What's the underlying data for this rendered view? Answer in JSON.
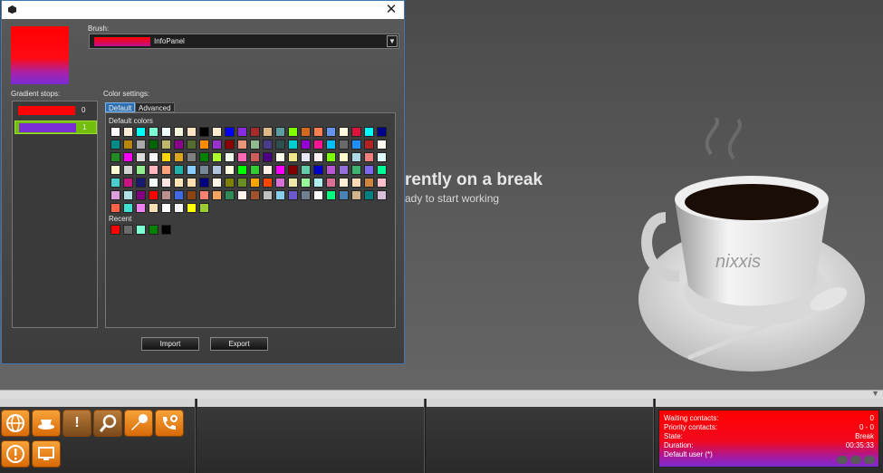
{
  "dialog": {
    "brush_label": "Brush:",
    "brush_name": "InfoPanel",
    "gradient_stops_label": "Gradient stops:",
    "color_settings_label": "Color settings:",
    "tabs": [
      "Default",
      "Advanced"
    ],
    "default_colors_label": "Default colors",
    "recent_label": "Recent",
    "stops": [
      {
        "index": "0",
        "color": "#ff0000"
      },
      {
        "index": "1",
        "color": "#7b2ed6"
      }
    ],
    "import_label": "Import",
    "export_label": "Export",
    "close_symbol": "✕",
    "default_colors": [
      [
        "#fff8ff",
        "#faebd7",
        "#00ffff",
        "#7fffd4",
        "#f0ffff",
        "#f5f5dc",
        "#ffe4c4",
        "#000000",
        "#ffebcd",
        "#0000ff",
        "#8a2be2",
        "#a52a2a",
        "#deb887",
        "#5f9ea0",
        "#7fff00",
        "#d2691e",
        "#ff7f50",
        "#6495ed",
        "#fff8dc",
        "#dc143c",
        "#00ffff",
        "#00008b"
      ],
      [
        "#008b8b",
        "#b8860b",
        "#a9a9a9",
        "#006400",
        "#bdb76b",
        "#8b008b",
        "#556b2f",
        "#ff8c00",
        "#9932cc",
        "#8b0000",
        "#e9967a",
        "#8fbc8f",
        "#483d8b",
        "#2f4f4f",
        "#00ced1",
        "#9400d3",
        "#ff1493",
        "#00bfff",
        "#696969",
        "#1e90ff",
        "#b22222",
        "#fffaf0"
      ],
      [
        "#228b22",
        "#ff00ff",
        "#dcdcdc",
        "#f8f8ff",
        "#ffd700",
        "#daa520",
        "#808080",
        "#008000",
        "#adff2f",
        "#f0fff0",
        "#ff69b4",
        "#cd5c5c",
        "#4b0082",
        "#fffff0",
        "#f0e68c",
        "#e6e6fa",
        "#fff0f5",
        "#7cfc00",
        "#fffacd",
        "#add8e6",
        "#f08080",
        "#e0ffff"
      ],
      [
        "#fafad2",
        "#d3d3d3",
        "#90ee90",
        "#ffb6c1",
        "#ffa07a",
        "#20b2aa",
        "#87cefa",
        "#778899",
        "#b0c4de",
        "#ffffe0",
        "#00ff00",
        "#32cd32",
        "#faf0e6",
        "#ff00ff",
        "#800000",
        "#66cdaa",
        "#0000cd",
        "#ba55d3",
        "#9370db",
        "#3cb371",
        "#7b68ee",
        "#00fa9a"
      ],
      [
        "#48d1cc",
        "#c71585",
        "#191970",
        "#f5fffa",
        "#ffe4e1",
        "#ffe4b5",
        "#ffdead",
        "#000080",
        "#fdf5e6",
        "#808000",
        "#6b8e23",
        "#ffa500",
        "#ff4500",
        "#da70d6",
        "#eee8aa",
        "#98fb98",
        "#afeeee",
        "#db7093",
        "#ffefd5",
        "#ffdab9",
        "#cd853f",
        "#ffc0cb"
      ],
      [
        "#dda0dd",
        "#b0e0e6",
        "#800080",
        "#ff0000",
        "#bc8f8f",
        "#4169e1",
        "#8b4513",
        "#fa8072",
        "#f4a460",
        "#2e8b57",
        "#fff5ee",
        "#a0522d",
        "#c0c0c0",
        "#87ceeb",
        "#6a5acd",
        "#708090",
        "#fffafa",
        "#00ff7f",
        "#4682b4",
        "#d2b48c",
        "#008080",
        "#d8bfd8"
      ],
      [
        "#ff6347",
        "#40e0d0",
        "#ee82ee",
        "#f5deb3",
        "#ffffff",
        "#f5f5f5",
        "#ffff00",
        "#9acd32"
      ]
    ],
    "recent_colors": [
      "#ff0000",
      "#6a6a6a",
      "#7fffd4",
      "#007f00",
      "#000000"
    ]
  },
  "break_screen": {
    "title": "rently on a break",
    "subtitle": "ady to start working"
  },
  "status": {
    "waiting_label": "Waiting contacts:",
    "waiting_value": "0",
    "priority_label": "Priority contacts:",
    "priority_value": "0 - 0",
    "state_label": "State:",
    "state_value": "Break",
    "duration_label": "Duration:",
    "duration_value": "00:35:33",
    "user_label": "Default user (*)"
  },
  "taskbar_icons": [
    "globe-icon",
    "coffee-icon",
    "exclamation-icon",
    "magnifier-icon",
    "wrench-icon",
    "phone-plus-icon",
    "alert-circle-icon",
    "monitor-icon"
  ],
  "colors": {
    "accent": "#f39a2a",
    "status_red": "#ff0000",
    "status_purple": "#7a2bd0",
    "selection_green": "#73be0d"
  }
}
